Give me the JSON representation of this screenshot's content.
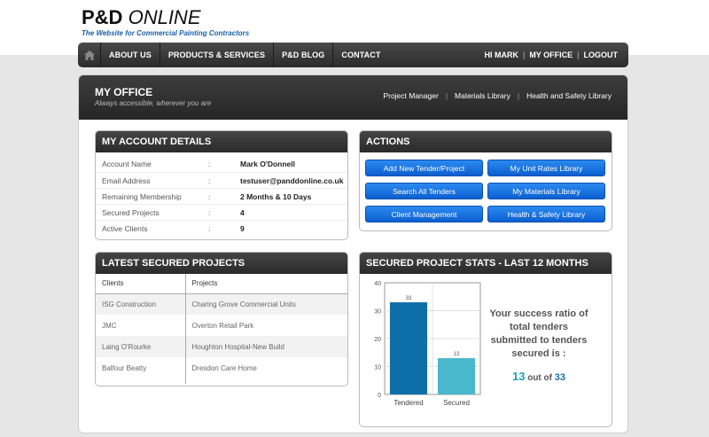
{
  "logo": {
    "title_bold": "P&D",
    "title_light": "ONLINE",
    "tagline": "The Website for Commercial Painting Contractors"
  },
  "nav": {
    "items": [
      "ABOUT US",
      "PRODUCTS & SERVICES",
      "P&D BLOG",
      "CONTACT"
    ],
    "greeting": "HI MARK",
    "my_office": "MY OFFICE",
    "logout": "LOGOUT"
  },
  "office": {
    "title": "MY OFFICE",
    "subtitle": "Always accessible, wherever you are",
    "links": [
      "Project Manager",
      "Materials Library",
      "Health and Safety Library"
    ]
  },
  "account": {
    "heading": "MY ACCOUNT DETAILS",
    "rows": [
      {
        "label": "Account Name",
        "value": "Mark O'Donnell"
      },
      {
        "label": "Email Address",
        "value": "testuser@panddonline.co.uk"
      },
      {
        "label": "Remaining Membership",
        "value": "2 Months & 10 Days"
      },
      {
        "label": "Secured Projects",
        "value": "4"
      },
      {
        "label": "Active Clients",
        "value": "9"
      }
    ]
  },
  "actions": {
    "heading": "ACTIONS",
    "buttons": [
      "Add New Tender/Project",
      "My Unit Rates Library",
      "Search All Tenders",
      "My Materials Library",
      "Client Management",
      "Health & Safety Library"
    ]
  },
  "projects": {
    "heading": "LATEST SECURED PROJECTS",
    "columns": [
      "Clients",
      "Projects"
    ],
    "rows": [
      [
        "ISG Construction",
        "Charing Grove Commercial Units"
      ],
      [
        "JMC",
        "Overton Retail Park"
      ],
      [
        "Laing O'Rourke",
        "Houghton Hospital-New Build"
      ],
      [
        "Balfour Beatty",
        "Dresdon Care Home"
      ]
    ]
  },
  "stats": {
    "heading": "SECURED PROJECT STATS - LAST 12 MONTHS",
    "text": "Your success ratio of total tenders submitted to tenders secured is :",
    "secured": "13",
    "out_of": "out of",
    "total": "33"
  },
  "chart_data": {
    "type": "bar",
    "categories": [
      "Tendered",
      "Secured"
    ],
    "values": [
      33,
      13
    ],
    "ylim": [
      0,
      40
    ],
    "yticks": [
      0,
      10,
      20,
      30,
      40
    ],
    "colors": [
      "#0e6fa8",
      "#4ab8cc"
    ],
    "title": "",
    "xlabel": "",
    "ylabel": ""
  }
}
